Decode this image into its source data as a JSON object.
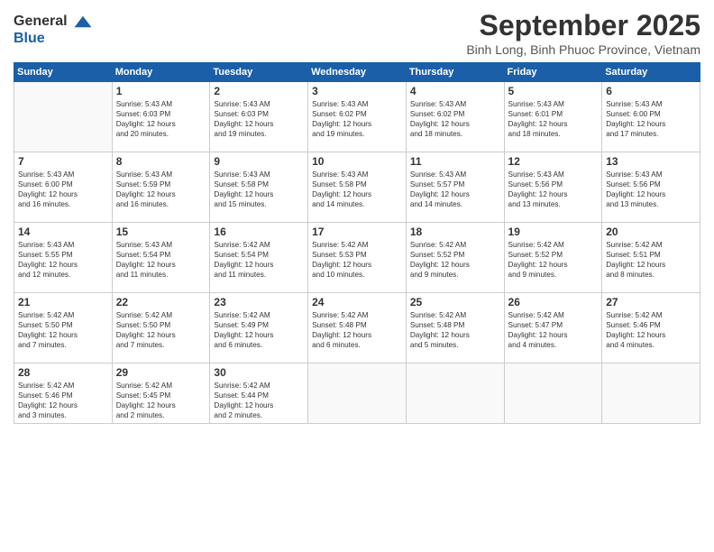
{
  "header": {
    "logo_line1": "General",
    "logo_line2": "Blue",
    "month": "September 2025",
    "location": "Binh Long, Binh Phuoc Province, Vietnam"
  },
  "days_of_week": [
    "Sunday",
    "Monday",
    "Tuesday",
    "Wednesday",
    "Thursday",
    "Friday",
    "Saturday"
  ],
  "weeks": [
    [
      {
        "day": "",
        "info": ""
      },
      {
        "day": "1",
        "info": "Sunrise: 5:43 AM\nSunset: 6:03 PM\nDaylight: 12 hours\nand 20 minutes."
      },
      {
        "day": "2",
        "info": "Sunrise: 5:43 AM\nSunset: 6:03 PM\nDaylight: 12 hours\nand 19 minutes."
      },
      {
        "day": "3",
        "info": "Sunrise: 5:43 AM\nSunset: 6:02 PM\nDaylight: 12 hours\nand 19 minutes."
      },
      {
        "day": "4",
        "info": "Sunrise: 5:43 AM\nSunset: 6:02 PM\nDaylight: 12 hours\nand 18 minutes."
      },
      {
        "day": "5",
        "info": "Sunrise: 5:43 AM\nSunset: 6:01 PM\nDaylight: 12 hours\nand 18 minutes."
      },
      {
        "day": "6",
        "info": "Sunrise: 5:43 AM\nSunset: 6:00 PM\nDaylight: 12 hours\nand 17 minutes."
      }
    ],
    [
      {
        "day": "7",
        "info": "Sunrise: 5:43 AM\nSunset: 6:00 PM\nDaylight: 12 hours\nand 16 minutes."
      },
      {
        "day": "8",
        "info": "Sunrise: 5:43 AM\nSunset: 5:59 PM\nDaylight: 12 hours\nand 16 minutes."
      },
      {
        "day": "9",
        "info": "Sunrise: 5:43 AM\nSunset: 5:58 PM\nDaylight: 12 hours\nand 15 minutes."
      },
      {
        "day": "10",
        "info": "Sunrise: 5:43 AM\nSunset: 5:58 PM\nDaylight: 12 hours\nand 14 minutes."
      },
      {
        "day": "11",
        "info": "Sunrise: 5:43 AM\nSunset: 5:57 PM\nDaylight: 12 hours\nand 14 minutes."
      },
      {
        "day": "12",
        "info": "Sunrise: 5:43 AM\nSunset: 5:56 PM\nDaylight: 12 hours\nand 13 minutes."
      },
      {
        "day": "13",
        "info": "Sunrise: 5:43 AM\nSunset: 5:56 PM\nDaylight: 12 hours\nand 13 minutes."
      }
    ],
    [
      {
        "day": "14",
        "info": "Sunrise: 5:43 AM\nSunset: 5:55 PM\nDaylight: 12 hours\nand 12 minutes."
      },
      {
        "day": "15",
        "info": "Sunrise: 5:43 AM\nSunset: 5:54 PM\nDaylight: 12 hours\nand 11 minutes."
      },
      {
        "day": "16",
        "info": "Sunrise: 5:42 AM\nSunset: 5:54 PM\nDaylight: 12 hours\nand 11 minutes."
      },
      {
        "day": "17",
        "info": "Sunrise: 5:42 AM\nSunset: 5:53 PM\nDaylight: 12 hours\nand 10 minutes."
      },
      {
        "day": "18",
        "info": "Sunrise: 5:42 AM\nSunset: 5:52 PM\nDaylight: 12 hours\nand 9 minutes."
      },
      {
        "day": "19",
        "info": "Sunrise: 5:42 AM\nSunset: 5:52 PM\nDaylight: 12 hours\nand 9 minutes."
      },
      {
        "day": "20",
        "info": "Sunrise: 5:42 AM\nSunset: 5:51 PM\nDaylight: 12 hours\nand 8 minutes."
      }
    ],
    [
      {
        "day": "21",
        "info": "Sunrise: 5:42 AM\nSunset: 5:50 PM\nDaylight: 12 hours\nand 7 minutes."
      },
      {
        "day": "22",
        "info": "Sunrise: 5:42 AM\nSunset: 5:50 PM\nDaylight: 12 hours\nand 7 minutes."
      },
      {
        "day": "23",
        "info": "Sunrise: 5:42 AM\nSunset: 5:49 PM\nDaylight: 12 hours\nand 6 minutes."
      },
      {
        "day": "24",
        "info": "Sunrise: 5:42 AM\nSunset: 5:48 PM\nDaylight: 12 hours\nand 6 minutes."
      },
      {
        "day": "25",
        "info": "Sunrise: 5:42 AM\nSunset: 5:48 PM\nDaylight: 12 hours\nand 5 minutes."
      },
      {
        "day": "26",
        "info": "Sunrise: 5:42 AM\nSunset: 5:47 PM\nDaylight: 12 hours\nand 4 minutes."
      },
      {
        "day": "27",
        "info": "Sunrise: 5:42 AM\nSunset: 5:46 PM\nDaylight: 12 hours\nand 4 minutes."
      }
    ],
    [
      {
        "day": "28",
        "info": "Sunrise: 5:42 AM\nSunset: 5:46 PM\nDaylight: 12 hours\nand 3 minutes."
      },
      {
        "day": "29",
        "info": "Sunrise: 5:42 AM\nSunset: 5:45 PM\nDaylight: 12 hours\nand 2 minutes."
      },
      {
        "day": "30",
        "info": "Sunrise: 5:42 AM\nSunset: 5:44 PM\nDaylight: 12 hours\nand 2 minutes."
      },
      {
        "day": "",
        "info": ""
      },
      {
        "day": "",
        "info": ""
      },
      {
        "day": "",
        "info": ""
      },
      {
        "day": "",
        "info": ""
      }
    ]
  ]
}
